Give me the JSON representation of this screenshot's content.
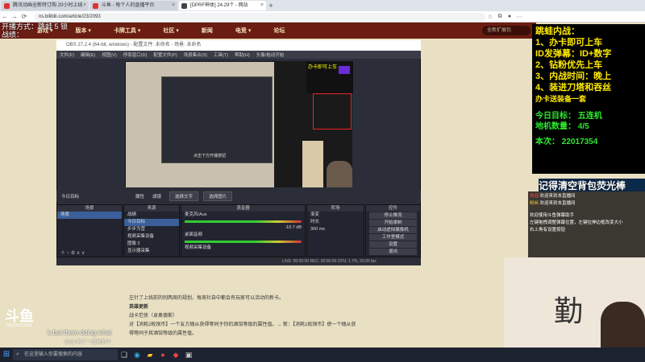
{
  "browser": {
    "tabs": [
      {
        "title": "腾讯动画全新特订购 20小时上线"
      },
      {
        "title": "斗鱼 - 每个人的直播平台"
      },
      {
        "title": "[DPRF神体] 24.29个 - 网站"
      }
    ],
    "new_tab": "+",
    "url": "ns.bilibili.com/article/23/2093",
    "nav": {
      "back": "←",
      "forward": "→",
      "refresh": "⟳"
    }
  },
  "site": {
    "nav_items": [
      "游戏 ▾",
      "版本 ▾",
      "卡牌工具 ▾",
      "社区 ▾",
      "新闻",
      "电竞 ▾",
      "论坛"
    ],
    "search_placeholder": "全新扩展包"
  },
  "obs": {
    "title": "OBS 27.2.4 (64-bit, windows) - 配置文件: 未命名 - 场景: 未命名",
    "menu": [
      "文件(F)",
      "编辑(E)",
      "视图(V)",
      "停靠窗口(D)",
      "配置文件(P)",
      "场景集合(S)",
      "工具(T)",
      "帮助(H)",
      "头像/拖动开始"
    ],
    "scene_toolbar": {
      "current": "今日目标",
      "props": "属性",
      "filters": "滤镜",
      "dock1": "选择文字",
      "dock2": "选择图片"
    },
    "preview_yellow_text": "办卡即可上车",
    "preview_caption": "点击下方开播按钮",
    "docks": {
      "scenes": {
        "title": "场景",
        "items": [
          "场景"
        ]
      },
      "sources": {
        "title": "来源",
        "items": [
          "战绩",
          "今日目标",
          "步步为营",
          "视频采集设备",
          "图像 2",
          "显示器采集"
        ]
      },
      "mixer": {
        "title": "混音器",
        "items": [
          {
            "name": "麦克风/Aux",
            "level": "-10.7 dB"
          },
          {
            "name": "桌面音频",
            "level": "0.0 dB"
          },
          {
            "name": "视频采集设备",
            "level": "0.0 dB"
          }
        ]
      },
      "transitions": {
        "title": "转场",
        "type": "渐变",
        "duration_label": "时长",
        "duration": "300 ms"
      },
      "controls": {
        "title": "控件",
        "buttons": [
          "停止推流",
          "开始录制",
          "启动虚拟摄像机",
          "工作室模式",
          "设置",
          "退出"
        ]
      }
    },
    "status": "LIVE: 00:00:00   REC: 00:00:00   CPU: 1.7%, 30.00 fps"
  },
  "overlay": {
    "top_left": [
      "开播方式：跳蛙 5 锁",
      "战绩："
    ],
    "lines": [
      "跳蛙内战：",
      "1、办卡即可上车",
      "ID发弹幕：ID+数字",
      "2、钻粉优先上车",
      "3、内战时间：晚上",
      "4、装进刀塔和吞丝",
      "办卡送装备一套"
    ],
    "goals": [
      "今日目标：",
      "五连机",
      "地机数量：",
      "4/5",
      "本次：",
      "22017354"
    ],
    "marquee": "记得清空背包荧光棒",
    "chat": [
      {
        "user": "欢迎",
        "text": "欢迎来到本直播间"
      },
      {
        "user": "粉丝",
        "text": "欢迎来到本直播间"
      },
      {
        "user": "",
        "text": "欢迎使用斗鱼弹幕助手"
      },
      {
        "user": "",
        "text": "左键拖拽调整弹幕位置，左键拉伸边框改变大小"
      },
      {
        "user": "",
        "text": "右上角有设置按钮"
      }
    ],
    "camera_calligraphy": "勤"
  },
  "article": {
    "lines": [
      "左针了上线前的则两周的规划，每周社自中都会有玩家可以活动的新卡。",
      "英雄更新",
      "战卡范侠（卓奥德斯）",
      "对【消耗2枚铜币】一个友方随从获得等同于你的酒馆等级的属性值。→ 新：【消耗1枚铜币】使一个随从获",
      "得等同于其酒馆等级的属性值。"
    ]
  },
  "douyu": {
    "logo": "斗鱼",
    "sub": "DOUYU.COM",
    "danmu1": "'s but there doing what",
    "danmu2": "WSB 刷了一组刷新卡"
  },
  "taskbar": {
    "search": "在这里输入你要搜索的内容"
  }
}
